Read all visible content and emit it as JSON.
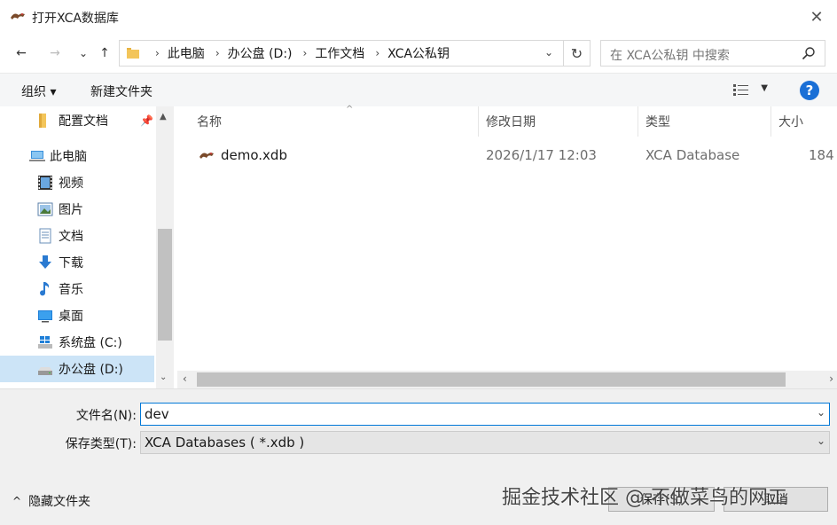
{
  "window": {
    "title": "打开XCA数据库",
    "close_glyph": "✕"
  },
  "nav": {
    "back_glyph": "←",
    "forward_glyph": "→",
    "recent_glyph": "⌄",
    "up_glyph": "↑",
    "breadcrumb": [
      "此电脑",
      "办公盘 (D:)",
      "工作文档",
      "XCA公私钥"
    ],
    "crumb_sep": "›",
    "dropdown_glyph": "⌄",
    "refresh_glyph": "↻",
    "search_placeholder": "在 XCA公私钥 中搜索"
  },
  "toolbar": {
    "organize": "组织 ▾",
    "new_folder": "新建文件夹",
    "view_drop": "▼",
    "help": "?"
  },
  "sidebar": {
    "pin_glyph": "📌",
    "items": [
      {
        "label": "配置文档",
        "icon": "folder-icon",
        "pinned": true
      },
      {
        "label": "此电脑",
        "icon": "computer-icon"
      },
      {
        "label": "视频",
        "icon": "video-icon"
      },
      {
        "label": "图片",
        "icon": "picture-icon"
      },
      {
        "label": "文档",
        "icon": "document-icon"
      },
      {
        "label": "下载",
        "icon": "download-icon"
      },
      {
        "label": "音乐",
        "icon": "music-icon"
      },
      {
        "label": "桌面",
        "icon": "desktop-icon"
      },
      {
        "label": "系统盘 (C:)",
        "icon": "windows-drive-icon"
      },
      {
        "label": "办公盘 (D:)",
        "icon": "drive-icon",
        "selected": true
      }
    ],
    "scroll_up": "▲",
    "scroll_down": "⌄"
  },
  "columns": {
    "name": "名称",
    "modified": "修改日期",
    "type": "类型",
    "size": "大小",
    "sort_glyph": "^"
  },
  "files": [
    {
      "name": "demo.xdb",
      "modified": "2026/1/17 12:03",
      "type": "XCA Database",
      "size": "184"
    }
  ],
  "hscroll": {
    "left": "‹",
    "right": "›"
  },
  "form": {
    "filename_label": "文件名(N):",
    "filename_value": "dev",
    "filename_drop": "⌄",
    "filetype_label": "保存类型(T):",
    "filetype_value": "XCA Databases ( *.xdb )",
    "filetype_drop": "⌄",
    "hide_folders_chevron": "^",
    "hide_folders": "隐藏文件夹",
    "open_button": "保存(S)",
    "cancel_button": "取消"
  },
  "watermark": "掘金技术社区 @ 不做菜鸟的网工",
  "colors": {
    "accent": "#0078d7",
    "selection": "#cce4f7",
    "help": "#1a6fd6"
  }
}
